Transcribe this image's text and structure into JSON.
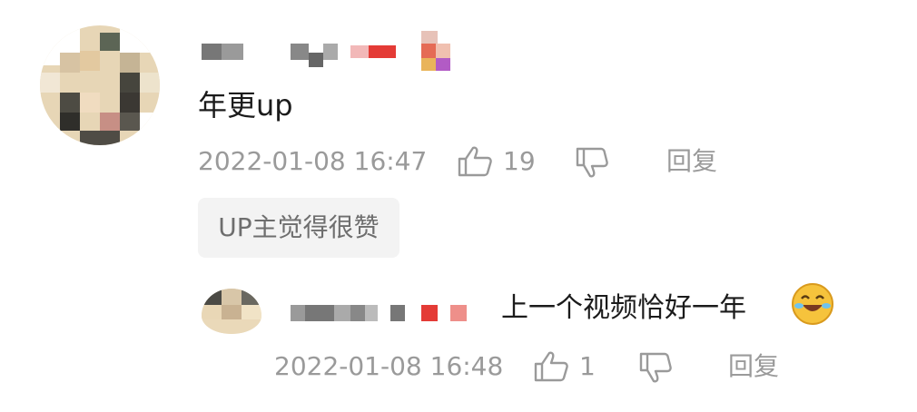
{
  "comment": {
    "text": "年更up",
    "timestamp": "2022-01-08 16:47",
    "like_count": "19",
    "reply_label": "回复",
    "like_icon": "thumbs-up-icon",
    "dislike_icon": "thumbs-down-icon",
    "badge": "UP主觉得很赞"
  },
  "reply": {
    "text": "上一个视频恰好一年",
    "emoji": "laughing-tears-emoji",
    "timestamp": "2022-01-08 16:48",
    "like_count": "1",
    "reply_label": "回复",
    "like_icon": "thumbs-up-icon",
    "dislike_icon": "thumbs-down-icon"
  },
  "colors": {
    "text_primary": "#1b1b1b",
    "text_meta": "#9a9a9a",
    "badge_bg": "#f3f3f3",
    "badge_text": "#6e6e6e"
  }
}
